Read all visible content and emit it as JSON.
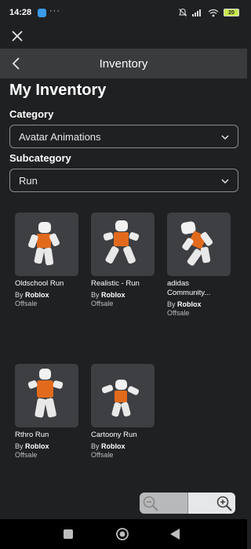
{
  "status_bar": {
    "time": "14:28",
    "dots": "···",
    "battery": "20"
  },
  "header": {
    "title": "Inventory"
  },
  "page_title": "My Inventory",
  "category": {
    "label": "Category",
    "value": "Avatar Animations"
  },
  "subcategory": {
    "label": "Subcategory",
    "value": "Run"
  },
  "items": [
    {
      "name": "Oldschool Run",
      "by_prefix": "By",
      "creator": "Roblox",
      "status": "Offsale"
    },
    {
      "name": "Realistic - Run",
      "by_prefix": "By",
      "creator": "Roblox",
      "status": "Offsale"
    },
    {
      "name": "adidas Community...",
      "by_prefix": "By",
      "creator": "Roblox",
      "status": "Offsale"
    },
    {
      "name": "Rthro Run",
      "by_prefix": "By",
      "creator": "Roblox",
      "status": "Offsale"
    },
    {
      "name": "Cartoony Run",
      "by_prefix": "By",
      "creator": "Roblox",
      "status": "Offsale"
    }
  ],
  "colors": {
    "background": "#1f2022",
    "navbar": "#393b3d",
    "card": "#3d3f42",
    "torso_orange": "#e26a1c"
  },
  "icons": {
    "close": "close-icon",
    "back": "chevron-left-icon",
    "dropdown": "chevron-down-icon",
    "zoom_out": "zoom-out-icon",
    "zoom_in": "zoom-in-icon"
  }
}
